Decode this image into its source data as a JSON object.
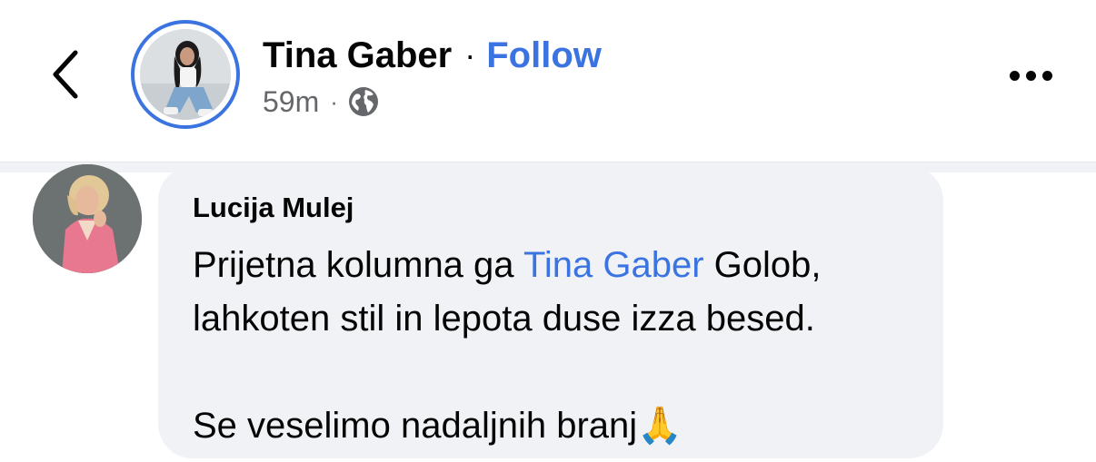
{
  "header": {
    "author_name": "Tina Gaber",
    "separator": "·",
    "follow_label": "Follow",
    "timestamp": "59m",
    "meta_separator": "·",
    "audience_icon": "globe-icon",
    "back_icon": "chevron-left-icon",
    "more_icon": "more-horizontal-icon"
  },
  "comment": {
    "author_name": "Lucija Mulej",
    "line1_prefix": "Prijetna kolumna ga ",
    "mention": "Tina Gaber",
    "line1_suffix": " Golob,",
    "line2": "lahkoten stil in lepota duse izza besed.",
    "line3": "Se veselimo nadaljnih branj",
    "emoji": "🙏"
  },
  "colors": {
    "accent": "#3b74e0",
    "text_primary": "#050505",
    "text_secondary": "#65676b",
    "bubble_bg": "#f0f2f5",
    "divider_bg": "#f0f2f5"
  }
}
